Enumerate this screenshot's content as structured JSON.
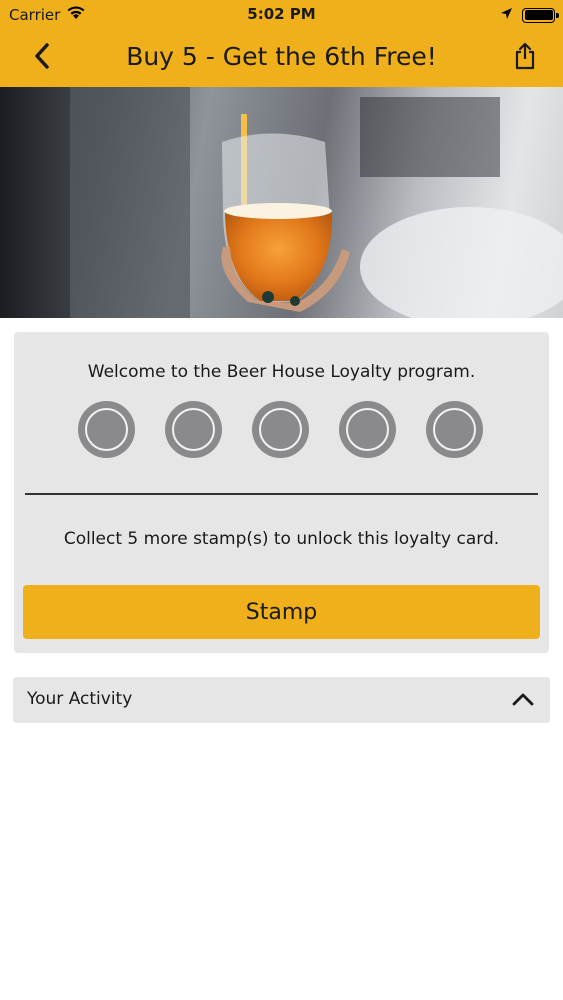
{
  "status_bar": {
    "carrier": "Carrier",
    "time": "5:02 PM"
  },
  "nav": {
    "title": "Buy 5 - Get the 6th Free!",
    "back_icon": "chevron-left-icon",
    "share_icon": "share-icon"
  },
  "hero": {
    "icon": "beer-glass-photo"
  },
  "card": {
    "welcome_text": "Welcome to the Beer House Loyalty program.",
    "stamps_total": 5,
    "stamps_collected": 0,
    "collect_text": "Collect 5 more stamp(s) to unlock this loyalty card.",
    "stamp_button_label": "Stamp"
  },
  "activity": {
    "label": "Your Activity",
    "expanded": true,
    "icon": "chevron-up-icon"
  },
  "colors": {
    "accent": "#EFB01C",
    "card_bg": "#E6E6E7",
    "stamp_empty": "#8A8A8D"
  }
}
